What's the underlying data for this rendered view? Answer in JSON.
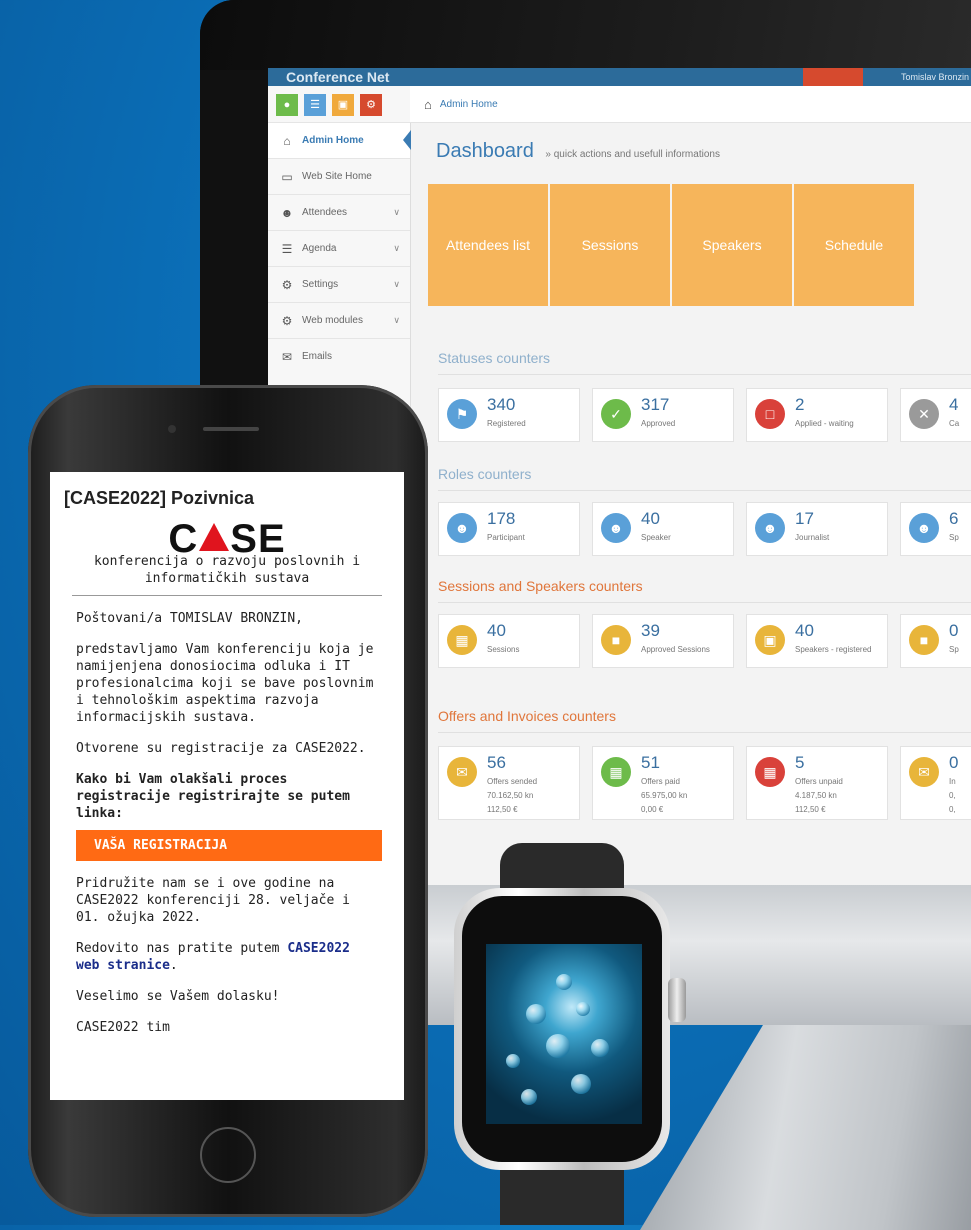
{
  "monitor": {
    "app_title": "Conference Net",
    "user_name": "Tomislav Bronzin",
    "sidebar": {
      "items": [
        {
          "label": "Admin Home",
          "icon": "home-icon",
          "active": true,
          "expandable": false
        },
        {
          "label": "Web Site Home",
          "icon": "monitor-icon",
          "active": false,
          "expandable": false
        },
        {
          "label": "Attendees",
          "icon": "users-icon",
          "active": false,
          "expandable": true
        },
        {
          "label": "Agenda",
          "icon": "list-icon",
          "active": false,
          "expandable": true
        },
        {
          "label": "Settings",
          "icon": "gears-icon",
          "active": false,
          "expandable": true
        },
        {
          "label": "Web modules",
          "icon": "gears-icon",
          "active": false,
          "expandable": true
        },
        {
          "label": "Emails",
          "icon": "envelope-icon",
          "active": false,
          "expandable": false
        }
      ]
    },
    "breadcrumb": "Admin Home",
    "dashboard": {
      "title": "Dashboard",
      "subtitle": "» quick actions and usefull informations"
    },
    "tiles": [
      "Attendees list",
      "Sessions",
      "Speakers",
      "Schedule"
    ],
    "sections": {
      "statuses": {
        "title": "Statuses counters",
        "cards": [
          {
            "num": "340",
            "label": "Registered",
            "color": "#5aa0d8",
            "icon": "flag-icon"
          },
          {
            "num": "317",
            "label": "Approved",
            "color": "#6dbb4a",
            "icon": "check-icon"
          },
          {
            "num": "2",
            "label": "Applied - waiting",
            "color": "#d9413a",
            "icon": "square-icon"
          },
          {
            "num": "4",
            "label": "Ca",
            "color": "#9a9a9a",
            "icon": "close-icon"
          }
        ]
      },
      "roles": {
        "title": "Roles counters",
        "cards": [
          {
            "num": "178",
            "label": "Participant",
            "color": "#5aa0d8",
            "icon": "group-icon"
          },
          {
            "num": "40",
            "label": "Speaker",
            "color": "#5aa0d8",
            "icon": "group-icon"
          },
          {
            "num": "17",
            "label": "Journalist",
            "color": "#5aa0d8",
            "icon": "group-icon"
          },
          {
            "num": "6",
            "label": "Sp",
            "color": "#5aa0d8",
            "icon": "group-icon"
          }
        ]
      },
      "sessions": {
        "title": "Sessions and Speakers counters",
        "cards": [
          {
            "num": "40",
            "label": "Sessions",
            "color": "#e8b53a",
            "icon": "book-icon"
          },
          {
            "num": "39",
            "label": "Approved Sessions",
            "color": "#e8b53a",
            "icon": "bookmark-icon"
          },
          {
            "num": "40",
            "label": "Speakers - registered",
            "color": "#e8b53a",
            "icon": "briefcase-icon"
          },
          {
            "num": "0",
            "label": "Sp",
            "color": "#e8b53a",
            "icon": "bookmark-icon"
          }
        ]
      },
      "offers": {
        "title": "Offers and Invoices counters",
        "cards": [
          {
            "num": "56",
            "label": "Offers sended",
            "sub1": "70.162,50 kn",
            "sub2": "112,50 €",
            "color": "#e8b53a",
            "icon": "envelope-icon"
          },
          {
            "num": "51",
            "label": "Offers paid",
            "sub1": "65.975,00 kn",
            "sub2": "0,00 €",
            "color": "#6dbb4a",
            "icon": "book-icon"
          },
          {
            "num": "5",
            "label": "Offers unpaid",
            "sub1": "4.187,50 kn",
            "sub2": "112,50 €",
            "color": "#d9413a",
            "icon": "calendar-icon"
          },
          {
            "num": "0",
            "label": "In",
            "sub1": "0,",
            "sub2": "0,",
            "color": "#e8b53a",
            "icon": "envelope-icon"
          }
        ]
      }
    }
  },
  "email": {
    "subject": "[CASE2022] Pozivnica",
    "logo_left": "C",
    "logo_right": "SE",
    "logo_color": "#e0141e",
    "tagline": "konferencija o razvoju poslovnih i informatičkih sustava",
    "greeting": "Poštovani/a TOMISLAV BRONZIN,",
    "intro": "predstavljamo Vam konferenciju koja je namijenjena donosiocima odluka i IT profesionalcima koji se bave poslovnim i tehnološkim aspektima razvoja informacijskih sustava.",
    "open": "Otvorene su registracije za CASE2022.",
    "register_prompt": "Kako bi Vam olakšali proces registracije registrirajte se putem linka:",
    "cta_label": "VAŠA REGISTRACIJA",
    "cta_color": "#ff6a14",
    "join": "Pridružite nam se i ove godine na CASE2022 konferenciji 28. veljače i 01. ožujka 2022.",
    "follow_prefix": "Redovito nas pratite putem ",
    "follow_link": "CASE2022 web stranice",
    "follow_suffix": ".",
    "closing": "Veselimo se Vašem dolasku!",
    "signature": "CASE2022 tim"
  }
}
